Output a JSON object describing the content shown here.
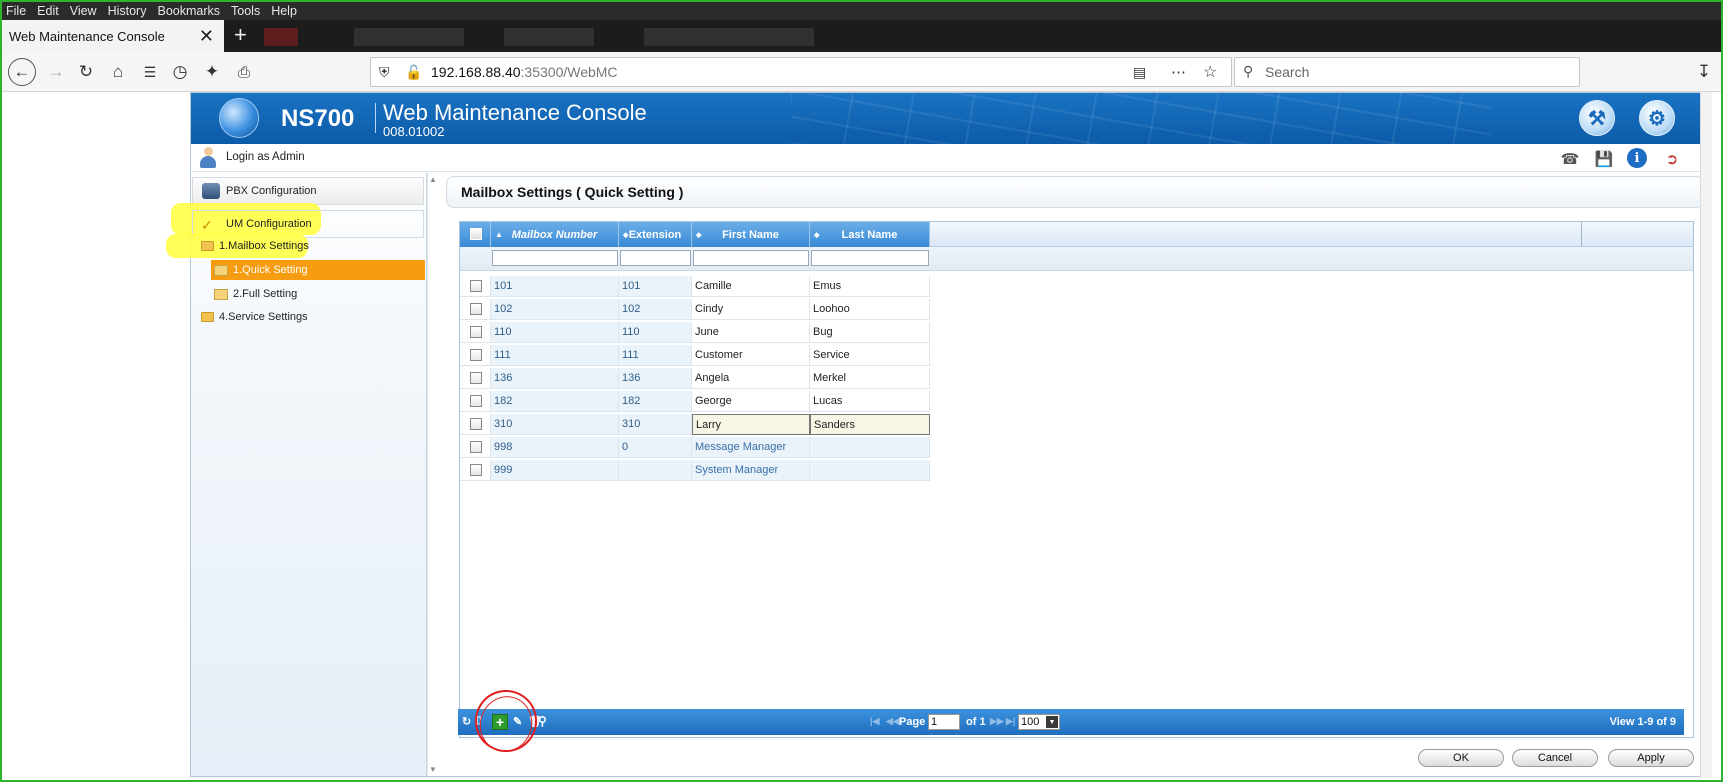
{
  "browser": {
    "menu": [
      "File",
      "Edit",
      "View",
      "History",
      "Bookmarks",
      "Tools",
      "Help"
    ],
    "tab_title": "Web Maintenance Console",
    "url_host": "192.168.88.40",
    "url_rest": ":35300/WebMC",
    "search_placeholder": "Search"
  },
  "app": {
    "brand": "NS700",
    "title": "Web Maintenance Console",
    "version": "008.01002",
    "login": "Login as Admin"
  },
  "sidebar": {
    "pbx": "PBX Configuration",
    "um": "UM Configuration",
    "mailbox_settings": "1.Mailbox Settings",
    "quick_setting": "1.Quick Setting",
    "full_setting": "2.Full Setting",
    "service_settings": "4.Service Settings"
  },
  "panel": {
    "title": "Mailbox Settings ( Quick Setting )"
  },
  "table": {
    "columns": [
      "Mailbox Number",
      "Extension",
      "First Name",
      "Last Name"
    ],
    "rows": [
      [
        "101",
        "101",
        "Camille",
        "Emus"
      ],
      [
        "102",
        "102",
        "Cindy",
        "Loohoo"
      ],
      [
        "110",
        "110",
        "June",
        "Bug"
      ],
      [
        "111",
        "111",
        "Customer",
        "Service"
      ],
      [
        "136",
        "136",
        "Angela",
        "Merkel"
      ],
      [
        "182",
        "182",
        "George",
        "Lucas"
      ],
      [
        "310",
        "310",
        "Larry",
        "Sanders"
      ],
      [
        "998",
        "0",
        "Message Manager",
        ""
      ],
      [
        "999",
        "",
        "System Manager",
        ""
      ]
    ]
  },
  "pager": {
    "page_label": "Page",
    "page_value": "1",
    "of_label": "of 1",
    "per_page": "100",
    "view": "View 1-9 of 9"
  },
  "buttons": {
    "ok": "OK",
    "cancel": "Cancel",
    "apply": "Apply"
  }
}
